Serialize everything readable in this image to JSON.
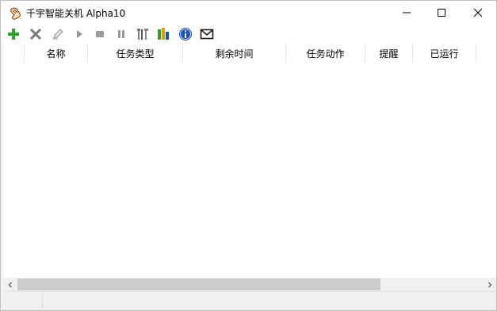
{
  "window": {
    "title": "千宇智能关机 Alpha10",
    "app_icon": "hand-pointer-icon",
    "controls": {
      "minimize": "minimize-icon",
      "maximize": "maximize-icon",
      "close": "close-icon"
    }
  },
  "toolbar": {
    "buttons": [
      {
        "name": "add",
        "icon": "plus-icon",
        "color": "#2ea32e",
        "enabled": true
      },
      {
        "name": "delete",
        "icon": "x-icon",
        "color": "#7a7a7a",
        "enabled": true
      },
      {
        "name": "edit",
        "icon": "pencil-icon",
        "color": "#9a9a9a",
        "enabled": false
      },
      {
        "name": "start",
        "icon": "play-icon",
        "color": "#9a9a9a",
        "enabled": false
      },
      {
        "name": "stop",
        "icon": "stop-icon",
        "color": "#9a9a9a",
        "enabled": false
      },
      {
        "name": "pause",
        "icon": "pause-icon",
        "color": "#9a9a9a",
        "enabled": false
      },
      {
        "name": "settings",
        "icon": "tools-icon",
        "color": "#7a7a7a",
        "enabled": true
      },
      {
        "name": "statistics",
        "icon": "bar-chart-icon",
        "color": "#e8a000",
        "enabled": true
      },
      {
        "name": "about",
        "icon": "info-icon",
        "color": "#1a56b8",
        "enabled": true
      },
      {
        "name": "feedback",
        "icon": "mail-icon",
        "color": "#1a1a1a",
        "enabled": true
      }
    ]
  },
  "list": {
    "columns": [
      "名称",
      "任务类型",
      "剩余时间",
      "任务动作",
      "提醒",
      "已运行"
    ],
    "rows": []
  },
  "scrollbar": {
    "left_arrow": "chevron-left-icon",
    "right_arrow": "chevron-right-icon"
  }
}
